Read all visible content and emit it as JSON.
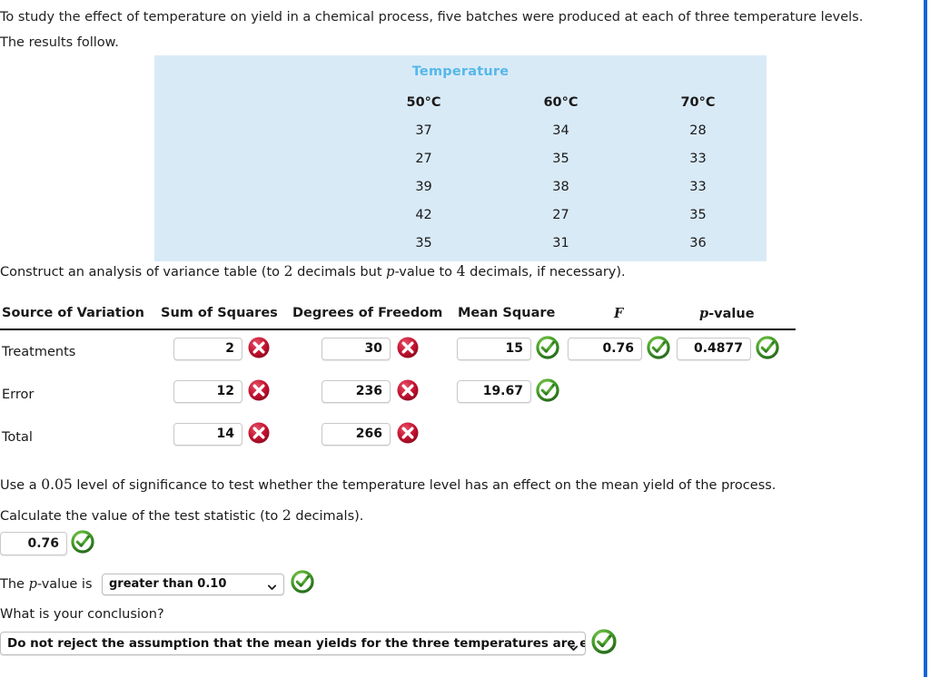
{
  "intro": {
    "line1": "To study the effect of temperature on yield in a chemical process, five batches were produced at each of three temperature levels.",
    "line2": "The results follow."
  },
  "data_table": {
    "title": "Temperature",
    "columns": [
      "50°C",
      "60°C",
      "70°C"
    ],
    "rows": [
      [
        "37",
        "34",
        "28"
      ],
      [
        "27",
        "35",
        "33"
      ],
      [
        "39",
        "38",
        "33"
      ],
      [
        "42",
        "27",
        "35"
      ],
      [
        "35",
        "31",
        "36"
      ]
    ],
    "background_color": "#d9eaf7",
    "title_color": "#56b8e8"
  },
  "construct_prompt": {
    "pre": "Construct an analysis of variance table (to ",
    "decimals1": "2",
    "mid": " decimals but ",
    "p_italic": "p",
    "mid2": "-value to ",
    "decimals2": "4",
    "post": " decimals, if necessary)."
  },
  "anova": {
    "headers": {
      "source": "Source of Variation",
      "sum_of_squares": "Sum of Squares",
      "degrees_of_freedom": "Degrees of Freedom",
      "mean_square": "Mean Square",
      "f": "F",
      "p_value_italic": "p",
      "p_value_rest": "-value"
    },
    "rows": [
      {
        "label": "Treatments",
        "ss": "2",
        "ss_status": "incorrect-icon",
        "df": "30",
        "df_status": "incorrect-icon",
        "ms": "15",
        "ms_status": "correct-icon",
        "f": "0.76",
        "f_status": "correct-icon",
        "p": "0.4877",
        "p_status": "correct-icon"
      },
      {
        "label": "Error",
        "ss": "12",
        "ss_status": "incorrect-icon",
        "df": "236",
        "df_status": "incorrect-icon",
        "ms": "19.67",
        "ms_status": "correct-icon",
        "f": "",
        "f_status": "",
        "p": "",
        "p_status": ""
      },
      {
        "label": "Total",
        "ss": "14",
        "ss_status": "incorrect-icon",
        "df": "266",
        "df_status": "incorrect-icon",
        "ms": "",
        "ms_status": "",
        "f": "",
        "f_status": "",
        "p": "",
        "p_status": ""
      }
    ]
  },
  "significance": {
    "pre": "Use a ",
    "level": "0.05",
    "post": " level of significance to test whether the temperature level has an effect on the mean yield of the process."
  },
  "calculate": {
    "pre": "Calculate the value of the test statistic (to ",
    "decimals": "2",
    "post": " decimals)."
  },
  "test_statistic": {
    "value": "0.76",
    "status": "correct-icon"
  },
  "p_value_question": {
    "label_pre": "The ",
    "label_italic": "p",
    "label_post": "-value is",
    "selected": "greater than 0.10",
    "status": "correct-icon"
  },
  "conclusion_question": {
    "prompt": "What is your conclusion?",
    "selected": "Do not reject the assumption that the mean yields for the three temperatures are equal",
    "status": "correct-icon"
  },
  "colors": {
    "correct": "#3c8f1e",
    "incorrect": "#c4122f",
    "accent_rule": "#1565d8",
    "table_bg": "#d9eaf7",
    "table_title": "#56b8e8"
  }
}
